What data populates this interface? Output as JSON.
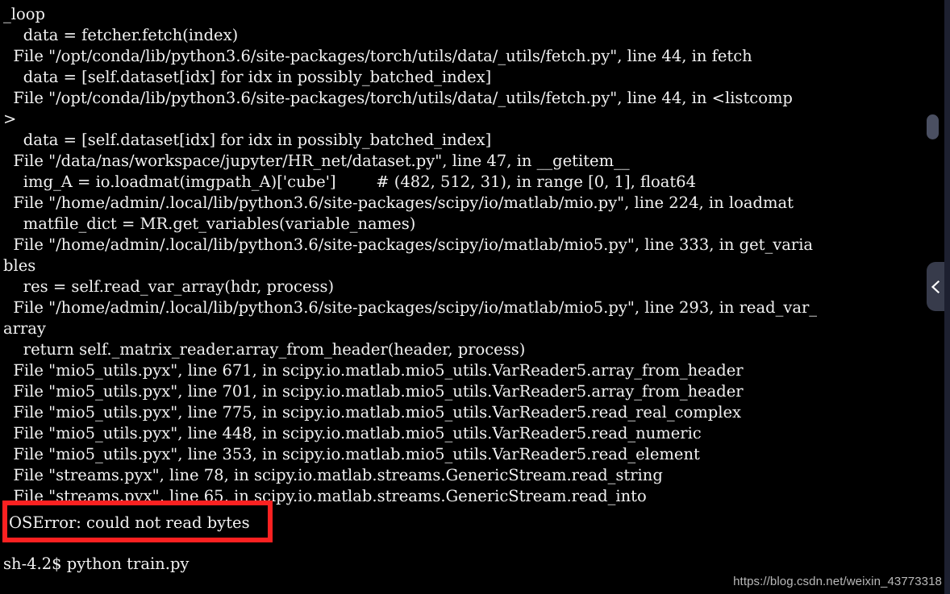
{
  "terminal": {
    "background_color": "#000000",
    "text_color": "#f2f2f2",
    "traceback_lines": [
      "_loop",
      "    data = fetcher.fetch(index)",
      "  File \"/opt/conda/lib/python3.6/site-packages/torch/utils/data/_utils/fetch.py\", line 44, in fetch",
      "    data = [self.dataset[idx] for idx in possibly_batched_index]",
      "  File \"/opt/conda/lib/python3.6/site-packages/torch/utils/data/_utils/fetch.py\", line 44, in <listcomp",
      ">",
      "    data = [self.dataset[idx] for idx in possibly_batched_index]",
      "  File \"/data/nas/workspace/jupyter/HR_net/dataset.py\", line 47, in __getitem__",
      "    img_A = io.loadmat(imgpath_A)['cube']        # (482, 512, 31), in range [0, 1], float64",
      "  File \"/home/admin/.local/lib/python3.6/site-packages/scipy/io/matlab/mio.py\", line 224, in loadmat",
      "    matfile_dict = MR.get_variables(variable_names)",
      "  File \"/home/admin/.local/lib/python3.6/site-packages/scipy/io/matlab/mio5.py\", line 333, in get_varia",
      "bles",
      "    res = self.read_var_array(hdr, process)",
      "  File \"/home/admin/.local/lib/python3.6/site-packages/scipy/io/matlab/mio5.py\", line 293, in read_var_",
      "array",
      "    return self._matrix_reader.array_from_header(header, process)",
      "  File \"mio5_utils.pyx\", line 671, in scipy.io.matlab.mio5_utils.VarReader5.array_from_header",
      "  File \"mio5_utils.pyx\", line 701, in scipy.io.matlab.mio5_utils.VarReader5.array_from_header",
      "  File \"mio5_utils.pyx\", line 775, in scipy.io.matlab.mio5_utils.VarReader5.read_real_complex",
      "  File \"mio5_utils.pyx\", line 448, in scipy.io.matlab.mio5_utils.VarReader5.read_numeric",
      "  File \"mio5_utils.pyx\", line 353, in scipy.io.matlab.mio5_utils.VarReader5.read_element",
      "  File \"streams.pyx\", line 78, in scipy.io.matlab.streams.GenericStream.read_string",
      "  File \"streams.pyx\", line 65, in scipy.io.matlab.streams.GenericStream.read_into"
    ],
    "error_message": "OSError: could not read bytes",
    "prompt_line": "sh-4.2$ python train.py"
  },
  "annotation": {
    "box_color": "#fb2121",
    "box_label": "OSError: could not read bytes"
  },
  "chrome": {
    "scrollbar_thumb_color": "#4a4f61",
    "panel_tab_color": "#373b4b",
    "panel_tab_icon": "chevron-left-icon",
    "edge_strip_color": "#1d2030"
  },
  "watermark": {
    "text": "https://blog.csdn.net/weixin_43773318"
  }
}
